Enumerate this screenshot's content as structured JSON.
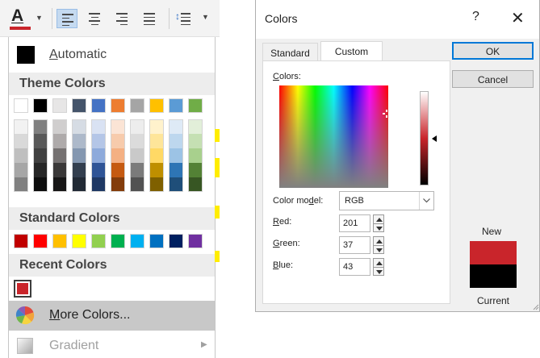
{
  "colors": {
    "recent": "#c9252b",
    "current": "#000000",
    "ok_border": "#0078d7",
    "menu_highlight": "#c8c8c8"
  },
  "ribbon": {
    "font_color_icon": "font-color-icon",
    "font_color_letter": "A",
    "font_color_value": "#c9252b",
    "align_icons": [
      "align-left-icon",
      "align-center-icon",
      "align-right-icon",
      "justify-icon"
    ],
    "active_align": "align-left-icon",
    "line_spacing_icon": "line-spacing-icon"
  },
  "dropdown": {
    "automatic_label": "Automatic",
    "theme_header": "Theme Colors",
    "standard_header": "Standard Colors",
    "recent_header": "Recent Colors",
    "more_colors_label": "More Colors...",
    "gradient_label": "Gradient",
    "theme_top": [
      "#ffffff",
      "#000000",
      "#e7e6e6",
      "#44546a",
      "#4472c4",
      "#ed7d31",
      "#a5a5a5",
      "#ffc000",
      "#5b9bd5",
      "#70ad47"
    ],
    "theme_shades": [
      [
        "#f2f2f2",
        "#d9d9d9",
        "#bfbfbf",
        "#a6a6a6",
        "#808080"
      ],
      [
        "#808080",
        "#595959",
        "#404040",
        "#262626",
        "#0d0d0d"
      ],
      [
        "#d0cece",
        "#aeaaaa",
        "#757171",
        "#3a3838",
        "#171616"
      ],
      [
        "#d6dce4",
        "#adb9ca",
        "#8497b0",
        "#333f4f",
        "#222a35"
      ],
      [
        "#d9e2f3",
        "#b4c6e7",
        "#8eaadb",
        "#2f5496",
        "#1f3864"
      ],
      [
        "#fbe4d5",
        "#f7cbac",
        "#f4b083",
        "#c55a11",
        "#833c0b"
      ],
      [
        "#ededed",
        "#dbdbdb",
        "#c9c9c9",
        "#7b7b7b",
        "#525252"
      ],
      [
        "#fff2cc",
        "#fee599",
        "#ffd965",
        "#bf8f00",
        "#7f6000"
      ],
      [
        "#deeaf6",
        "#bdd7ee",
        "#9cc3e5",
        "#2e75b5",
        "#1f4e79"
      ],
      [
        "#e2efd9",
        "#c5e0b3",
        "#a8d08d",
        "#538135",
        "#375623"
      ]
    ],
    "standard": [
      "#c00000",
      "#ff0000",
      "#ffc000",
      "#ffff00",
      "#92d050",
      "#00b050",
      "#00b0f0",
      "#0070c0",
      "#002060",
      "#7030a0"
    ],
    "recent": [
      "#c9252b"
    ]
  },
  "dialog": {
    "title": "Colors",
    "help": "?",
    "close": "✕",
    "tabs": [
      "Standard",
      "Custom"
    ],
    "active_tab": "Custom",
    "colors_label": "Colors:",
    "color_model_label": "Color model:",
    "color_model_value": "RGB",
    "red_label": "Red:",
    "green_label": "Green:",
    "blue_label": "Blue:",
    "red": "201",
    "green": "37",
    "blue": "43",
    "ok_label": "OK",
    "cancel_label": "Cancel",
    "new_label": "New",
    "current_label": "Current",
    "luminance_level": 0.5
  }
}
